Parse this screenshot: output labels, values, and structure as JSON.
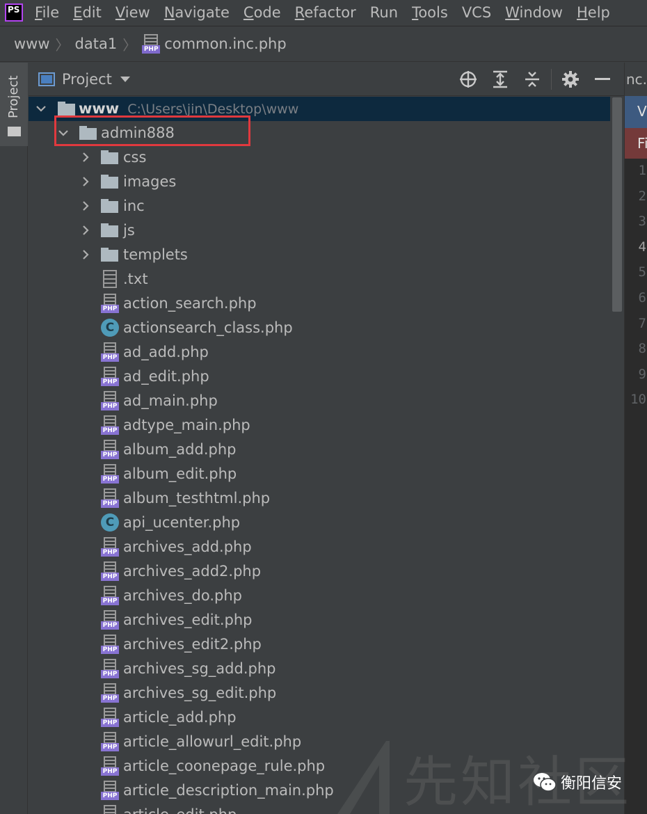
{
  "menu": {
    "logo_text": "PS",
    "items": [
      {
        "mnemonic": "F",
        "rest": "ile"
      },
      {
        "mnemonic": "E",
        "rest": "dit"
      },
      {
        "mnemonic": "V",
        "rest": "iew"
      },
      {
        "mnemonic": "N",
        "rest": "avigate"
      },
      {
        "mnemonic": "C",
        "rest": "ode"
      },
      {
        "mnemonic": "R",
        "rest": "efactor"
      },
      {
        "mnemonic": "",
        "rest": "Run"
      },
      {
        "mnemonic": "T",
        "rest": "ools"
      },
      {
        "mnemonic": "",
        "rest": "VCS"
      },
      {
        "mnemonic": "W",
        "rest": "indow"
      },
      {
        "mnemonic": "H",
        "rest": "elp"
      }
    ]
  },
  "breadcrumb": {
    "items": [
      "www",
      "data1",
      "common.inc.php"
    ],
    "badge": "PHP"
  },
  "stripe": {
    "project_label": "Project"
  },
  "panel": {
    "title": "Project",
    "tool_icons": [
      "locate-icon",
      "expand-all-icon",
      "collapse-all-icon",
      "gear-icon",
      "minimize-icon"
    ]
  },
  "tree": {
    "root": {
      "name": "www",
      "path": "C:\\Users\\jin\\Desktop\\www"
    },
    "admin": {
      "name": "admin888"
    },
    "folders": [
      "css",
      "images",
      "inc",
      "js",
      "templets"
    ],
    "files": [
      {
        "name": ".txt",
        "icon": "text"
      },
      {
        "name": "action_search.php",
        "icon": "php"
      },
      {
        "name": "actionsearch_class.php",
        "icon": "class"
      },
      {
        "name": "ad_add.php",
        "icon": "php"
      },
      {
        "name": "ad_edit.php",
        "icon": "php"
      },
      {
        "name": "ad_main.php",
        "icon": "php"
      },
      {
        "name": "adtype_main.php",
        "icon": "php"
      },
      {
        "name": "album_add.php",
        "icon": "php"
      },
      {
        "name": "album_edit.php",
        "icon": "php"
      },
      {
        "name": "album_testhtml.php",
        "icon": "php"
      },
      {
        "name": "api_ucenter.php",
        "icon": "class"
      },
      {
        "name": "archives_add.php",
        "icon": "php"
      },
      {
        "name": "archives_add2.php",
        "icon": "php"
      },
      {
        "name": "archives_do.php",
        "icon": "php"
      },
      {
        "name": "archives_edit.php",
        "icon": "php"
      },
      {
        "name": "archives_edit2.php",
        "icon": "php"
      },
      {
        "name": "archives_sg_add.php",
        "icon": "php"
      },
      {
        "name": "archives_sg_edit.php",
        "icon": "php"
      },
      {
        "name": "article_add.php",
        "icon": "php"
      },
      {
        "name": "article_allowurl_edit.php",
        "icon": "php"
      },
      {
        "name": "article_coonepage_rule.php",
        "icon": "php"
      },
      {
        "name": "article_description_main.php",
        "icon": "php"
      },
      {
        "name": "article_edit.php",
        "icon": "php"
      }
    ],
    "php_badge": "PHP",
    "class_badge": "C"
  },
  "editor": {
    "tab_text": "nc.p",
    "v_text": "V",
    "fi_text": "Fi",
    "line_numbers": [
      "1",
      "2",
      "3",
      "4",
      "5",
      "6",
      "7",
      "8",
      "9",
      "10"
    ],
    "active_line": "4"
  },
  "watermark": {
    "site_text": "先知社区",
    "account_text": "衡阳信安"
  }
}
